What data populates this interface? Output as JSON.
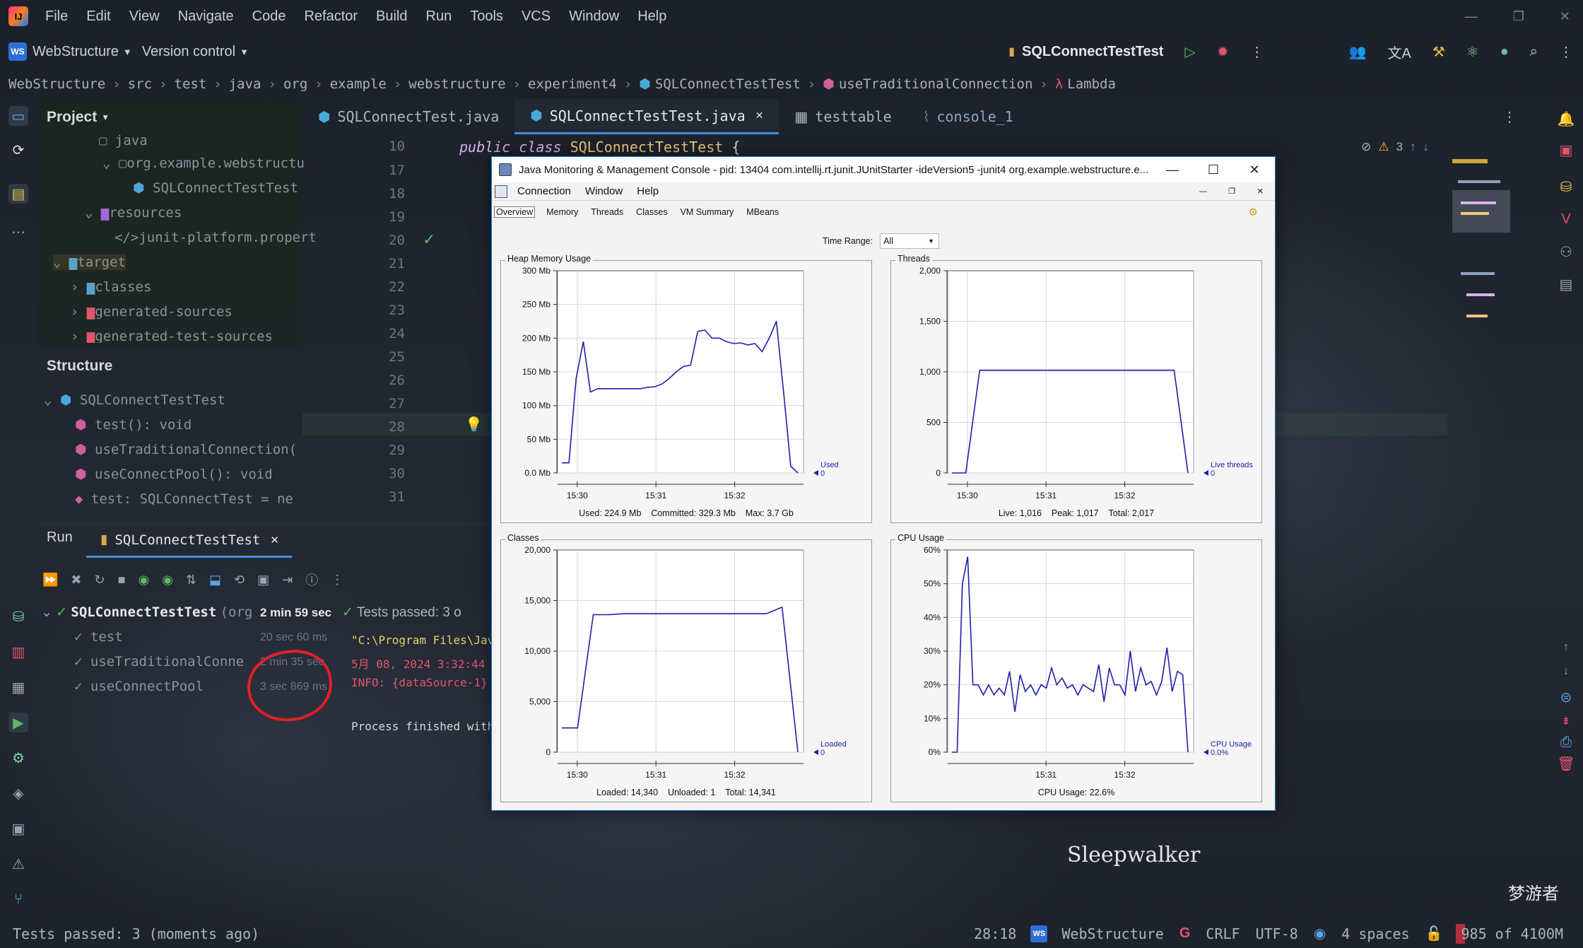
{
  "menubar": {
    "items": [
      "File",
      "Edit",
      "View",
      "Navigate",
      "Code",
      "Refactor",
      "Build",
      "Run",
      "Tools",
      "VCS",
      "Window",
      "Help"
    ]
  },
  "toolbar": {
    "project": "WebStructure",
    "vcs": "Version control",
    "run_config": "SQLConnectTestTest"
  },
  "breadcrumb": [
    "WebStructure",
    "src",
    "test",
    "java",
    "org",
    "example",
    "webstructure",
    "experiment4",
    "SQLConnectTestTest",
    "useTraditionalConnection",
    "Lambda"
  ],
  "project_panel": {
    "title": "Project",
    "tree": [
      "java",
      "org.example.webstructu",
      "SQLConnectTestTest",
      "resources",
      "junit-platform.propert",
      "target",
      "classes",
      "generated-sources",
      "generated-test-sources"
    ]
  },
  "structure_panel": {
    "title": "Structure",
    "items": [
      "SQLConnectTestTest",
      "test(): void",
      "useTraditionalConnection(",
      "useConnectPool(): void",
      "test: SQLConnectTest = ne"
    ]
  },
  "editor": {
    "tabs": [
      "SQLConnectTest.java",
      "SQLConnectTestTest.java",
      "testtable",
      "console_1"
    ],
    "line_numbers": [
      "10",
      "17",
      "18",
      "19",
      "20",
      "21",
      "22",
      "23",
      "24",
      "25",
      "26",
      "27",
      "28",
      "29",
      "30",
      "31"
    ],
    "code_first_line": {
      "kw1": "public",
      "kw2": "class",
      "name": "SQLConnectTestTest",
      "brace": "{"
    },
    "warning_count": "3"
  },
  "run_panel": {
    "title": "Run",
    "tab": "SQLConnectTestTest",
    "root": {
      "name": "SQLConnectTestTest",
      "suffix": "(org",
      "time": "2 min 59 sec"
    },
    "status": "Tests passed: 3 o",
    "tests": [
      {
        "name": "test",
        "time": "20 sec 60 ms"
      },
      {
        "name": "useTraditionalConne",
        "time": "2 min 35 sec"
      },
      {
        "name": "useConnectPool",
        "time": "3 sec 869 ms"
      }
    ],
    "console": [
      "\"C:\\Program Files\\Java",
      "5月 08, 2024 3:32:44 下",
      "INFO: {dataSource-1} i",
      "Process finished with"
    ]
  },
  "statusbar": {
    "message": "Tests passed: 3 (moments ago)",
    "position": "28:18",
    "project": "WebStructure",
    "line_sep": "CRLF",
    "encoding": "UTF-8",
    "indent": "4 spaces",
    "memory": "985 of 4100M"
  },
  "wallpaper": {
    "text1": "Sleepwalker",
    "text2": "梦游者"
  },
  "jmc": {
    "title": "Java Monitoring & Management Console - pid: 13404 com.intellij.rt.junit.JUnitStarter -ideVersion5 -junit4 org.example.webstructure.e...",
    "menu": [
      "Connection",
      "Window",
      "Help"
    ],
    "tabs": [
      "Overview",
      "Memory",
      "Threads",
      "Classes",
      "VM Summary",
      "MBeans"
    ],
    "time_range_label": "Time Range:",
    "time_range_value": "All",
    "x_ticks": [
      "15:30",
      "15:31",
      "15:32"
    ],
    "panels": {
      "heap": {
        "title": "Heap Memory Usage",
        "legend": [
          "Used",
          "0"
        ],
        "footer": [
          "Used: 224.9 Mb",
          "Committed: 329.3 Mb",
          "Max: 3.7 Gb"
        ]
      },
      "threads": {
        "title": "Threads",
        "legend": [
          "Live threads",
          "0"
        ],
        "footer": [
          "Live: 1,016",
          "Peak: 1,017",
          "Total: 2,017"
        ]
      },
      "classes": {
        "title": "Classes",
        "legend": [
          "Loaded",
          "0"
        ],
        "footer": [
          "Loaded: 14,340",
          "Unloaded: 1",
          "Total: 14,341"
        ]
      },
      "cpu": {
        "title": "CPU Usage",
        "legend": [
          "CPU Usage",
          "0.0%"
        ],
        "footer": [
          "CPU Usage: 22.6%"
        ]
      }
    }
  },
  "chart_data": [
    {
      "type": "line",
      "title": "Heap Memory Usage",
      "yticks": [
        "300 Mb",
        "250 Mb",
        "200 Mb",
        "150 Mb",
        "100 Mb",
        "50 Mb",
        "0.0 Mb"
      ],
      "ylim": [
        0,
        300
      ],
      "xticks": [
        "15:30",
        "15:31",
        "15:32"
      ],
      "series": [
        {
          "name": "Used",
          "values": [
            15,
            15,
            140,
            195,
            120,
            125,
            125,
            125,
            125,
            125,
            125,
            125,
            127,
            128,
            132,
            140,
            150,
            158,
            160,
            210,
            212,
            200,
            200,
            195,
            192,
            193,
            190,
            192,
            180,
            200,
            225,
            120,
            10,
            0
          ]
        }
      ]
    },
    {
      "type": "line",
      "title": "Threads",
      "yticks": [
        "2,000",
        "1,500",
        "1,000",
        "500",
        "0"
      ],
      "ylim": [
        0,
        2000
      ],
      "xticks": [
        "15:30",
        "15:31",
        "15:32"
      ],
      "series": [
        {
          "name": "Live threads",
          "values": [
            0,
            0,
            1016,
            1016,
            1016,
            1016,
            1016,
            1016,
            1016,
            1016,
            1016,
            1016,
            1016,
            1016,
            1016,
            1016,
            1016,
            0
          ]
        }
      ]
    },
    {
      "type": "line",
      "title": "Classes",
      "yticks": [
        "20,000",
        "15,000",
        "10,000",
        "5,000",
        "0"
      ],
      "ylim": [
        0,
        20000
      ],
      "xticks": [
        "15:30",
        "15:31",
        "15:32"
      ],
      "series": [
        {
          "name": "Loaded",
          "values": [
            2400,
            2400,
            13600,
            13600,
            13700,
            13700,
            13700,
            13700,
            13700,
            13700,
            13700,
            13700,
            13700,
            13700,
            14340,
            0
          ]
        }
      ]
    },
    {
      "type": "line",
      "title": "CPU Usage",
      "yticks": [
        "60%",
        "50%",
        "40%",
        "30%",
        "20%",
        "10%",
        "0%"
      ],
      "ylim": [
        0,
        60
      ],
      "xticks": [
        "15:31",
        "15:32"
      ],
      "series": [
        {
          "name": "CPU Usage",
          "values": [
            0,
            0,
            50,
            58,
            20,
            20,
            17,
            20,
            17,
            19,
            17,
            24,
            12,
            23,
            18,
            20,
            17,
            20,
            19,
            25,
            20,
            22,
            19,
            20,
            17,
            20,
            19,
            18,
            26,
            15,
            25,
            20,
            20,
            17,
            30,
            18,
            25,
            20,
            21,
            17,
            21,
            31,
            18,
            24,
            23,
            0
          ]
        }
      ]
    }
  ],
  "colors": {
    "accent": "#4a90d9",
    "chart_line": "#1f1fa8",
    "window_border": "#1778d4"
  }
}
